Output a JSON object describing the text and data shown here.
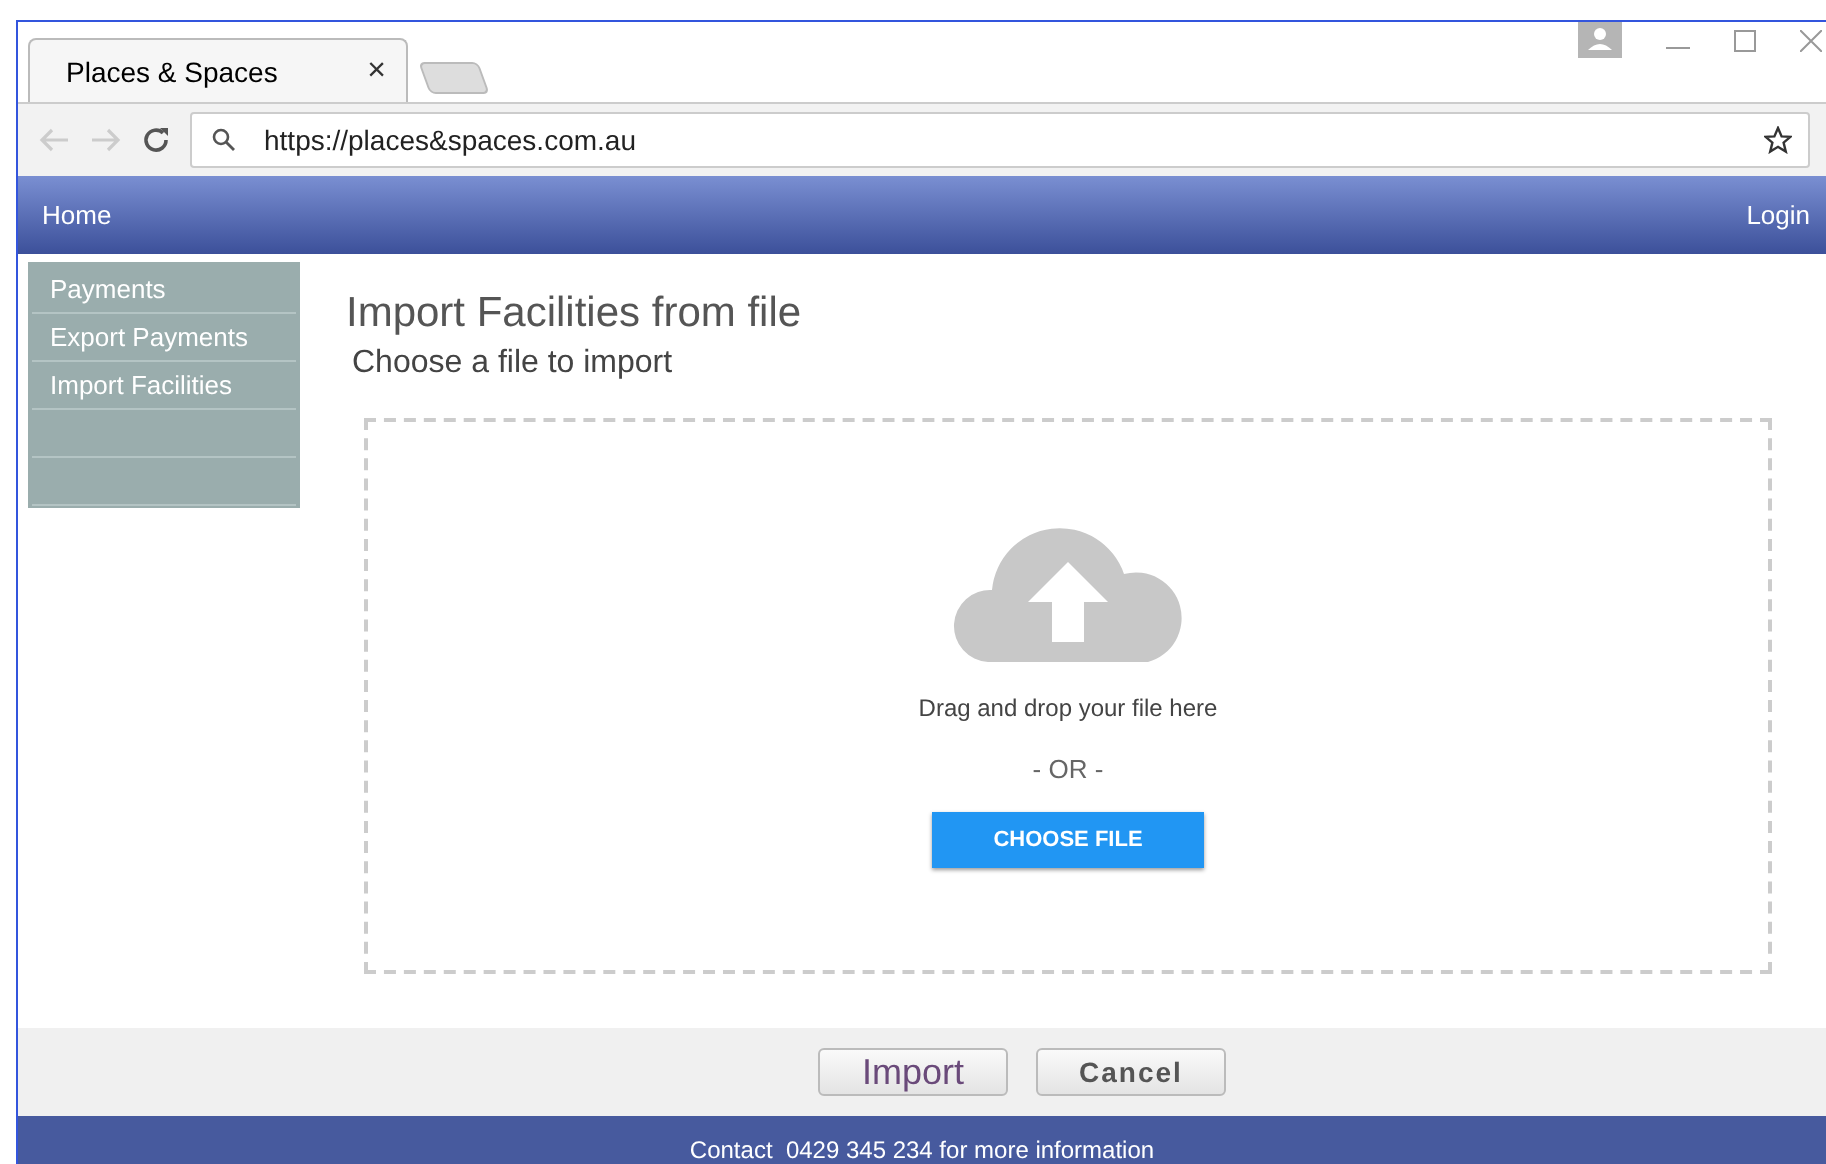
{
  "browser": {
    "tab_title": "Places & Spaces",
    "tab_close": "×",
    "url": "https://places&spaces.com.au"
  },
  "navbar": {
    "home": "Home",
    "login": "Login"
  },
  "sidebar": {
    "items": [
      {
        "label": "Payments"
      },
      {
        "label": "Export Payments"
      },
      {
        "label": "Import Facilities"
      }
    ]
  },
  "page": {
    "title": "Import Facilities from file",
    "subtitle": "Choose a file to import"
  },
  "dropzone": {
    "instruction": "Drag and drop your file here",
    "separator": "- OR -",
    "button": "CHOOSE FILE"
  },
  "buttons": [
    "Import",
    "Cancel"
  ],
  "footer": "Contact  0429 345 234 for more information"
}
